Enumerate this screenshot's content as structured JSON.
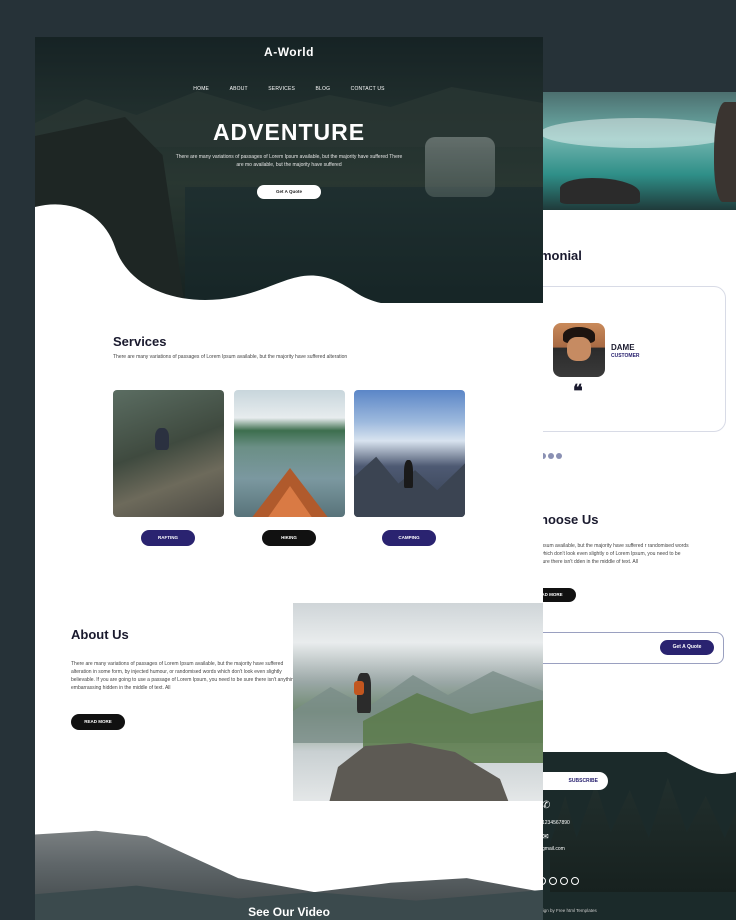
{
  "back_page": {
    "testimonial_title": "monial",
    "testimonial": {
      "name": "DAME",
      "role": "CUSTOMER",
      "quote_mark": "❝"
    },
    "choose_title": "hoose Us",
    "choose_text": "Ipsum available, but the majority have suffered r randomised words which don't look even slightly o of Lorem Ipsum, you need to be sure there isn't dden in the middle of text. All",
    "read_more": "AD MORE",
    "get_quote": "Get A Quote",
    "subscribe": "SUBSCRIBE",
    "phone": "1234567890",
    "email": "gmail.com",
    "design_credit": "esign by Free html Templates"
  },
  "main_page": {
    "brand": "A-World",
    "nav": [
      "HOME",
      "ABOUT",
      "SERVICES",
      "BLOG",
      "CONTACT US"
    ],
    "hero": {
      "title": "ADVENTURE",
      "text": "There are many variations of passages of Lorem Ipsum available, but the majority have suffered There are mo available, but the majority have suffered",
      "button": "Get A Quote"
    },
    "services": {
      "title": "Services",
      "subtitle": "There are many variations of passages of Lorem Ipsum available, but the majority have suffered alteration",
      "items": [
        "RAFTING",
        "HIKING",
        "CAMPING"
      ]
    },
    "about": {
      "title": "About Us",
      "text": "There are many variations of passages of Lorem Ipsum available, but the majority have suffered alteration in some form, by injected humour, or randomised words which don't look even slightly believable. If you are going to use a passage of Lorem Ipsum, you need to be sure there isn't anything embarrassing hidden in the middle of text. All",
      "button": "READ MORE"
    },
    "video_title": "See Our Video"
  }
}
